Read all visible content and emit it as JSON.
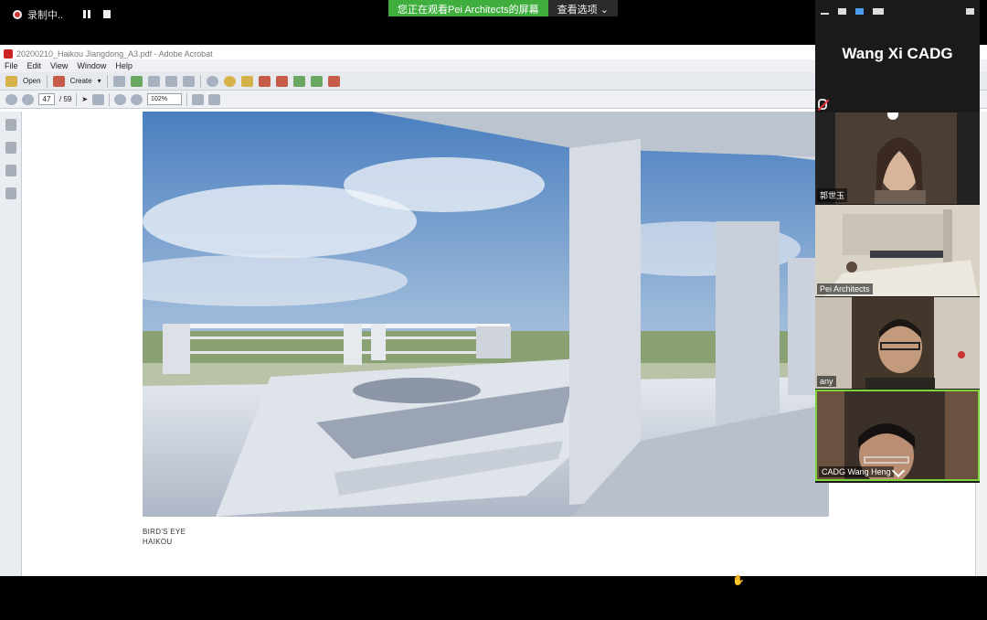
{
  "zoom_bar": {
    "recording_label": "录制中..",
    "share_banner": "您正在观看Pei Architects的屏幕",
    "view_options": "查看选项"
  },
  "acrobat": {
    "window_title": "20200210_Haikou Jiangdong_A3.pdf - Adobe Acrobat",
    "menu": [
      "File",
      "Edit",
      "View",
      "Window",
      "Help"
    ],
    "open_label": "Open",
    "create_label": "Create",
    "page_current": "47",
    "page_total": "/ 59",
    "zoom": "102%"
  },
  "document": {
    "caption_line1": "BIRD'S EYE",
    "caption_line2": "HAIKOU"
  },
  "video_panel": {
    "active_speaker": "Wang Xi CADG",
    "participants": [
      "郭世玉",
      "Pei Architects",
      "any",
      "CADG Wang Heng"
    ]
  },
  "colors": {
    "share_green": "#3fae3f",
    "active_tile_border": "#7cd43a",
    "panel_bg": "#1a1a1a"
  }
}
